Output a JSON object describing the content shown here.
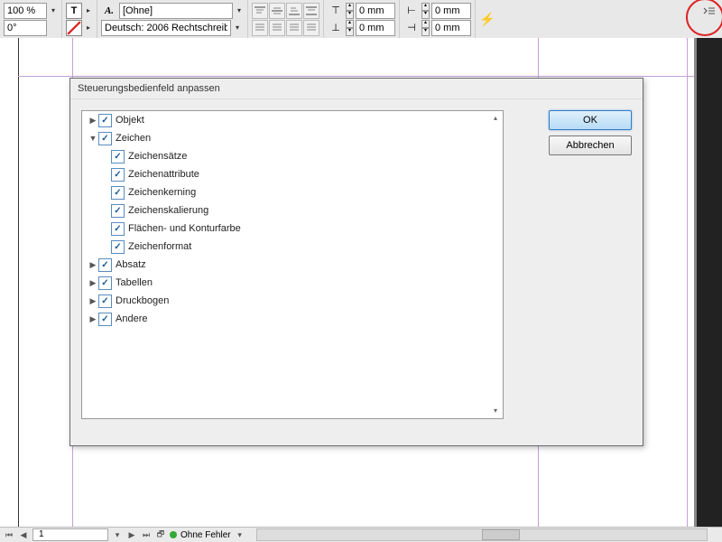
{
  "toolbar": {
    "zoom": "100 %",
    "rotate": "0°",
    "char_style": "[Ohne]",
    "language": "Deutsch: 2006 Rechtschreib",
    "inset_top": "0 mm",
    "inset_bottom": "0 mm",
    "inset_left": "0 mm",
    "inset_right": "0 mm"
  },
  "dialog": {
    "title": "Steuerungsbedienfeld anpassen",
    "ok": "OK",
    "cancel": "Abbrechen",
    "tree": {
      "objekt": "Objekt",
      "zeichen": "Zeichen",
      "zeichensaetze": "Zeichensätze",
      "zeichenattribute": "Zeichenattribute",
      "zeichenkerning": "Zeichenkerning",
      "zeichenskalierung": "Zeichenskalierung",
      "flaechen": "Flächen- und Konturfarbe",
      "zeichenformat": "Zeichenformat",
      "absatz": "Absatz",
      "tabellen": "Tabellen",
      "druckbogen": "Druckbogen",
      "andere": "Andere"
    }
  },
  "status": {
    "page": "1",
    "errors": "Ohne Fehler"
  }
}
